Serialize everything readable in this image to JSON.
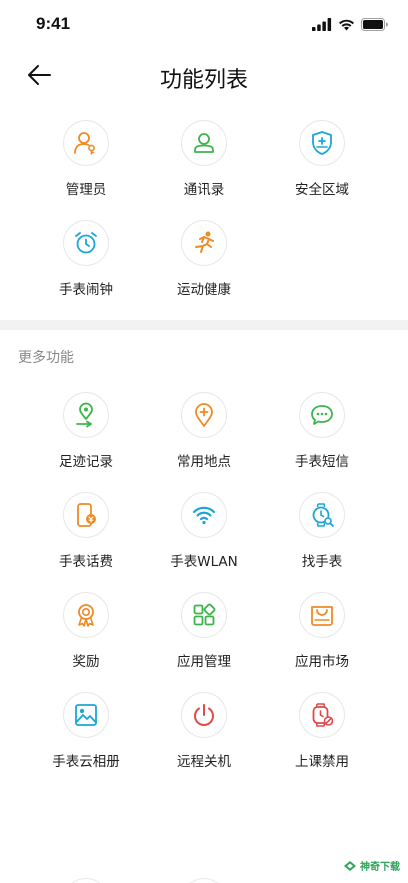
{
  "status": {
    "time": "9:41"
  },
  "header": {
    "title": "功能列表"
  },
  "top_items": [
    {
      "label": "管理员",
      "icon": "admin-user-icon",
      "color": "#f08a24"
    },
    {
      "label": "通讯录",
      "icon": "contacts-icon",
      "color": "#3cb54a"
    },
    {
      "label": "安全区域",
      "icon": "shield-icon",
      "color": "#1ba6d8"
    },
    {
      "label": "手表闹钟",
      "icon": "alarm-clock-icon",
      "color": "#1ba6d8"
    },
    {
      "label": "运动健康",
      "icon": "running-icon",
      "color": "#f08a24"
    }
  ],
  "more_section": {
    "title": "更多功能",
    "items": [
      {
        "label": "足迹记录",
        "icon": "footprint-location-icon",
        "color": "#3cb54a"
      },
      {
        "label": "常用地点",
        "icon": "add-location-icon",
        "color": "#f08a24"
      },
      {
        "label": "手表短信",
        "icon": "message-icon",
        "color": "#3cb54a"
      },
      {
        "label": "手表话费",
        "icon": "phone-bill-icon",
        "color": "#f08a24"
      },
      {
        "label": "手表WLAN",
        "icon": "wifi-icon",
        "color": "#1ba6d8"
      },
      {
        "label": "找手表",
        "icon": "find-watch-icon",
        "color": "#1ba6d8"
      },
      {
        "label": "奖励",
        "icon": "award-icon",
        "color": "#f08a24"
      },
      {
        "label": "应用管理",
        "icon": "app-grid-icon",
        "color": "#3cb54a"
      },
      {
        "label": "应用市场",
        "icon": "shopping-bag-icon",
        "color": "#f08a24"
      },
      {
        "label": "手表云相册",
        "icon": "photo-album-icon",
        "color": "#1ba6d8"
      },
      {
        "label": "远程关机",
        "icon": "power-icon",
        "color": "#e04a4a"
      },
      {
        "label": "上课禁用",
        "icon": "watch-disable-icon",
        "color": "#e04a4a"
      }
    ]
  },
  "watermark": {
    "text": "神奇下载"
  }
}
